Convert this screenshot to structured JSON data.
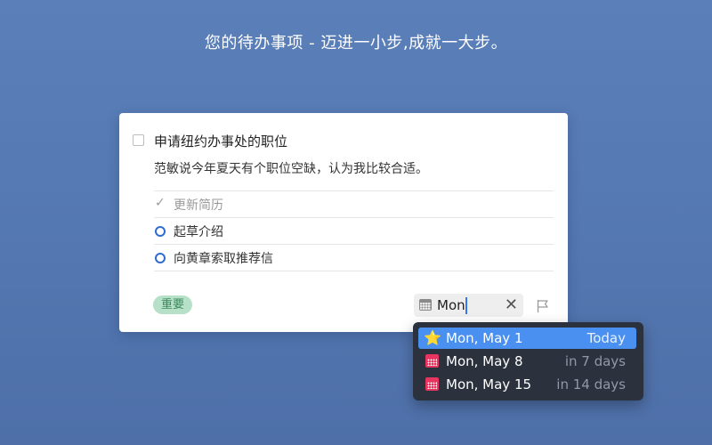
{
  "headline": "您的待办事项 - 迈进一小步,成就一大步。",
  "todo": {
    "title": "申请纽约办事处的职位",
    "notes": "范敏说今年夏天有个职位空缺，认为我比较合适。",
    "checklist": [
      {
        "label": "更新简历",
        "done": true
      },
      {
        "label": "起草介绍",
        "done": false
      },
      {
        "label": "向黄章索取推荐信",
        "done": false
      }
    ],
    "tag": "重要",
    "date_input": {
      "value": "Mon",
      "clear_icon": "✕"
    }
  },
  "date_suggestions": [
    {
      "icon": "star-icon",
      "glyph": "⭐",
      "date": "Mon, May 1",
      "relative": "Today",
      "selected": true
    },
    {
      "icon": "calendar-icon",
      "date": "Mon, May 8",
      "relative": "in 7 days",
      "selected": false
    },
    {
      "icon": "calendar-icon",
      "date": "Mon, May 15",
      "relative": "in 14 days",
      "selected": false
    }
  ],
  "colors": {
    "background": "#5579b3",
    "accent": "#4a90f0",
    "tag_bg": "#b6e0c8",
    "tag_text": "#3b8a5c",
    "checklist_circle": "#2f6bd0",
    "calendar_red": "#e8355f",
    "dropdown_bg": "#2b313d"
  }
}
